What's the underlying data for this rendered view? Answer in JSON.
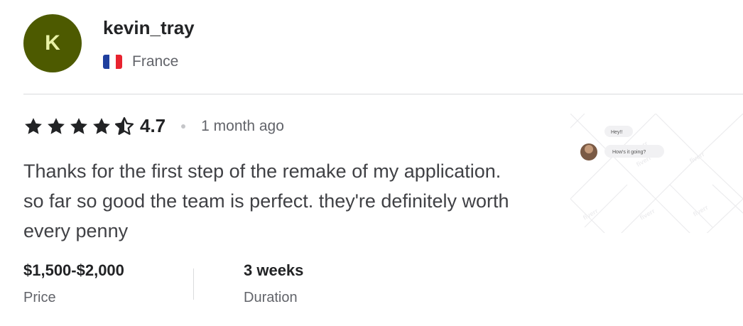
{
  "reviewer": {
    "initial": "K",
    "username": "kevin_tray",
    "country": "France",
    "avatar_color": "#4d5a00",
    "flag_colors": [
      "#1f3f9e",
      "#ffffff",
      "#e8232f"
    ]
  },
  "review": {
    "rating": "4.7",
    "stars_filled": 4.5,
    "time_ago": "1 month ago",
    "text": "Thanks for the first step of the remake of my application. so far so good the team is perfect. they're definitely worth every penny"
  },
  "details": {
    "price_value": "$1,500-$2,000",
    "price_label": "Price",
    "duration_value": "3 weeks",
    "duration_label": "Duration"
  },
  "thumbnail": {
    "bubble1": "Hey!!",
    "bubble2": "How's it going?",
    "watermark": "fiverr"
  }
}
